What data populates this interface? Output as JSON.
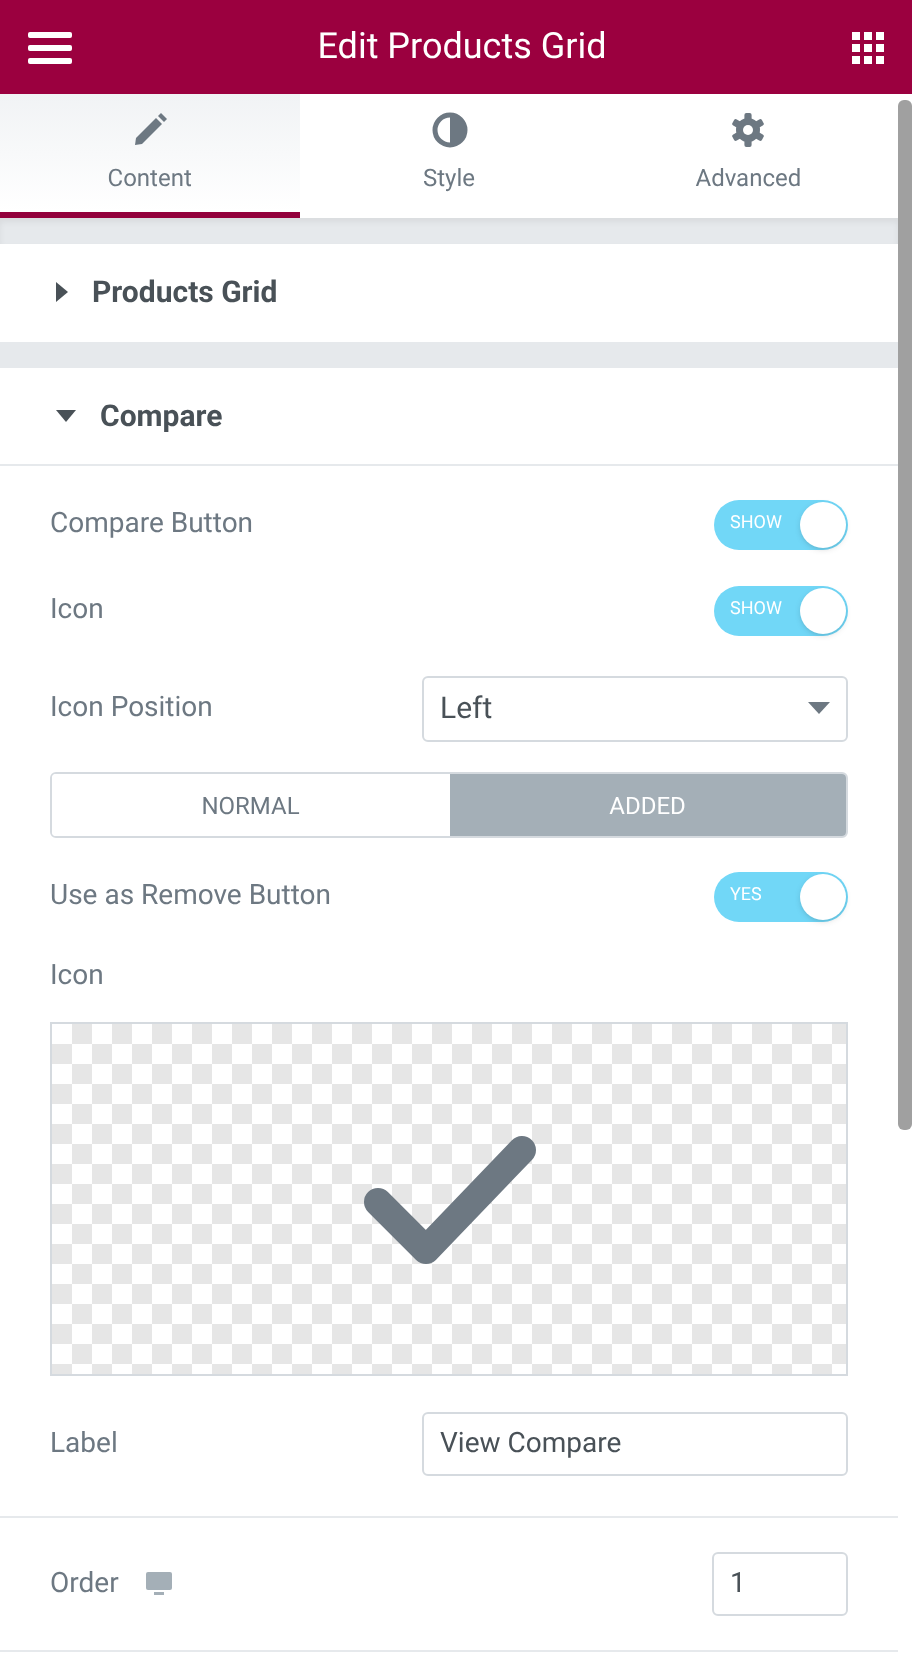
{
  "header": {
    "title": "Edit Products Grid"
  },
  "tabs": [
    {
      "label": "Content",
      "selected": true
    },
    {
      "label": "Style",
      "selected": false
    },
    {
      "label": "Advanced",
      "selected": false
    }
  ],
  "sections": [
    {
      "title": "Products Grid",
      "expanded": false
    },
    {
      "title": "Compare",
      "expanded": true,
      "controls": [
        {
          "kind": "toggle",
          "label": "Compare Button",
          "on": true,
          "text": "SHOW"
        },
        {
          "kind": "toggle",
          "label": "Icon",
          "on": true,
          "text": "SHOW"
        },
        {
          "kind": "select",
          "label": "Icon Position",
          "value": "Left"
        },
        {
          "kind": "states",
          "options": [
            {
              "label": "NORMAL",
              "selected": false
            },
            {
              "label": "ADDED",
              "selected": true
            }
          ]
        },
        {
          "kind": "toggle",
          "label": "Use as Remove Button",
          "on": true,
          "text": "YES"
        },
        {
          "kind": "icon_picker",
          "label": "Icon"
        },
        {
          "kind": "text",
          "label": "Label",
          "value": "View Compare"
        }
      ]
    }
  ],
  "order": {
    "label": "Order",
    "value": "1"
  }
}
